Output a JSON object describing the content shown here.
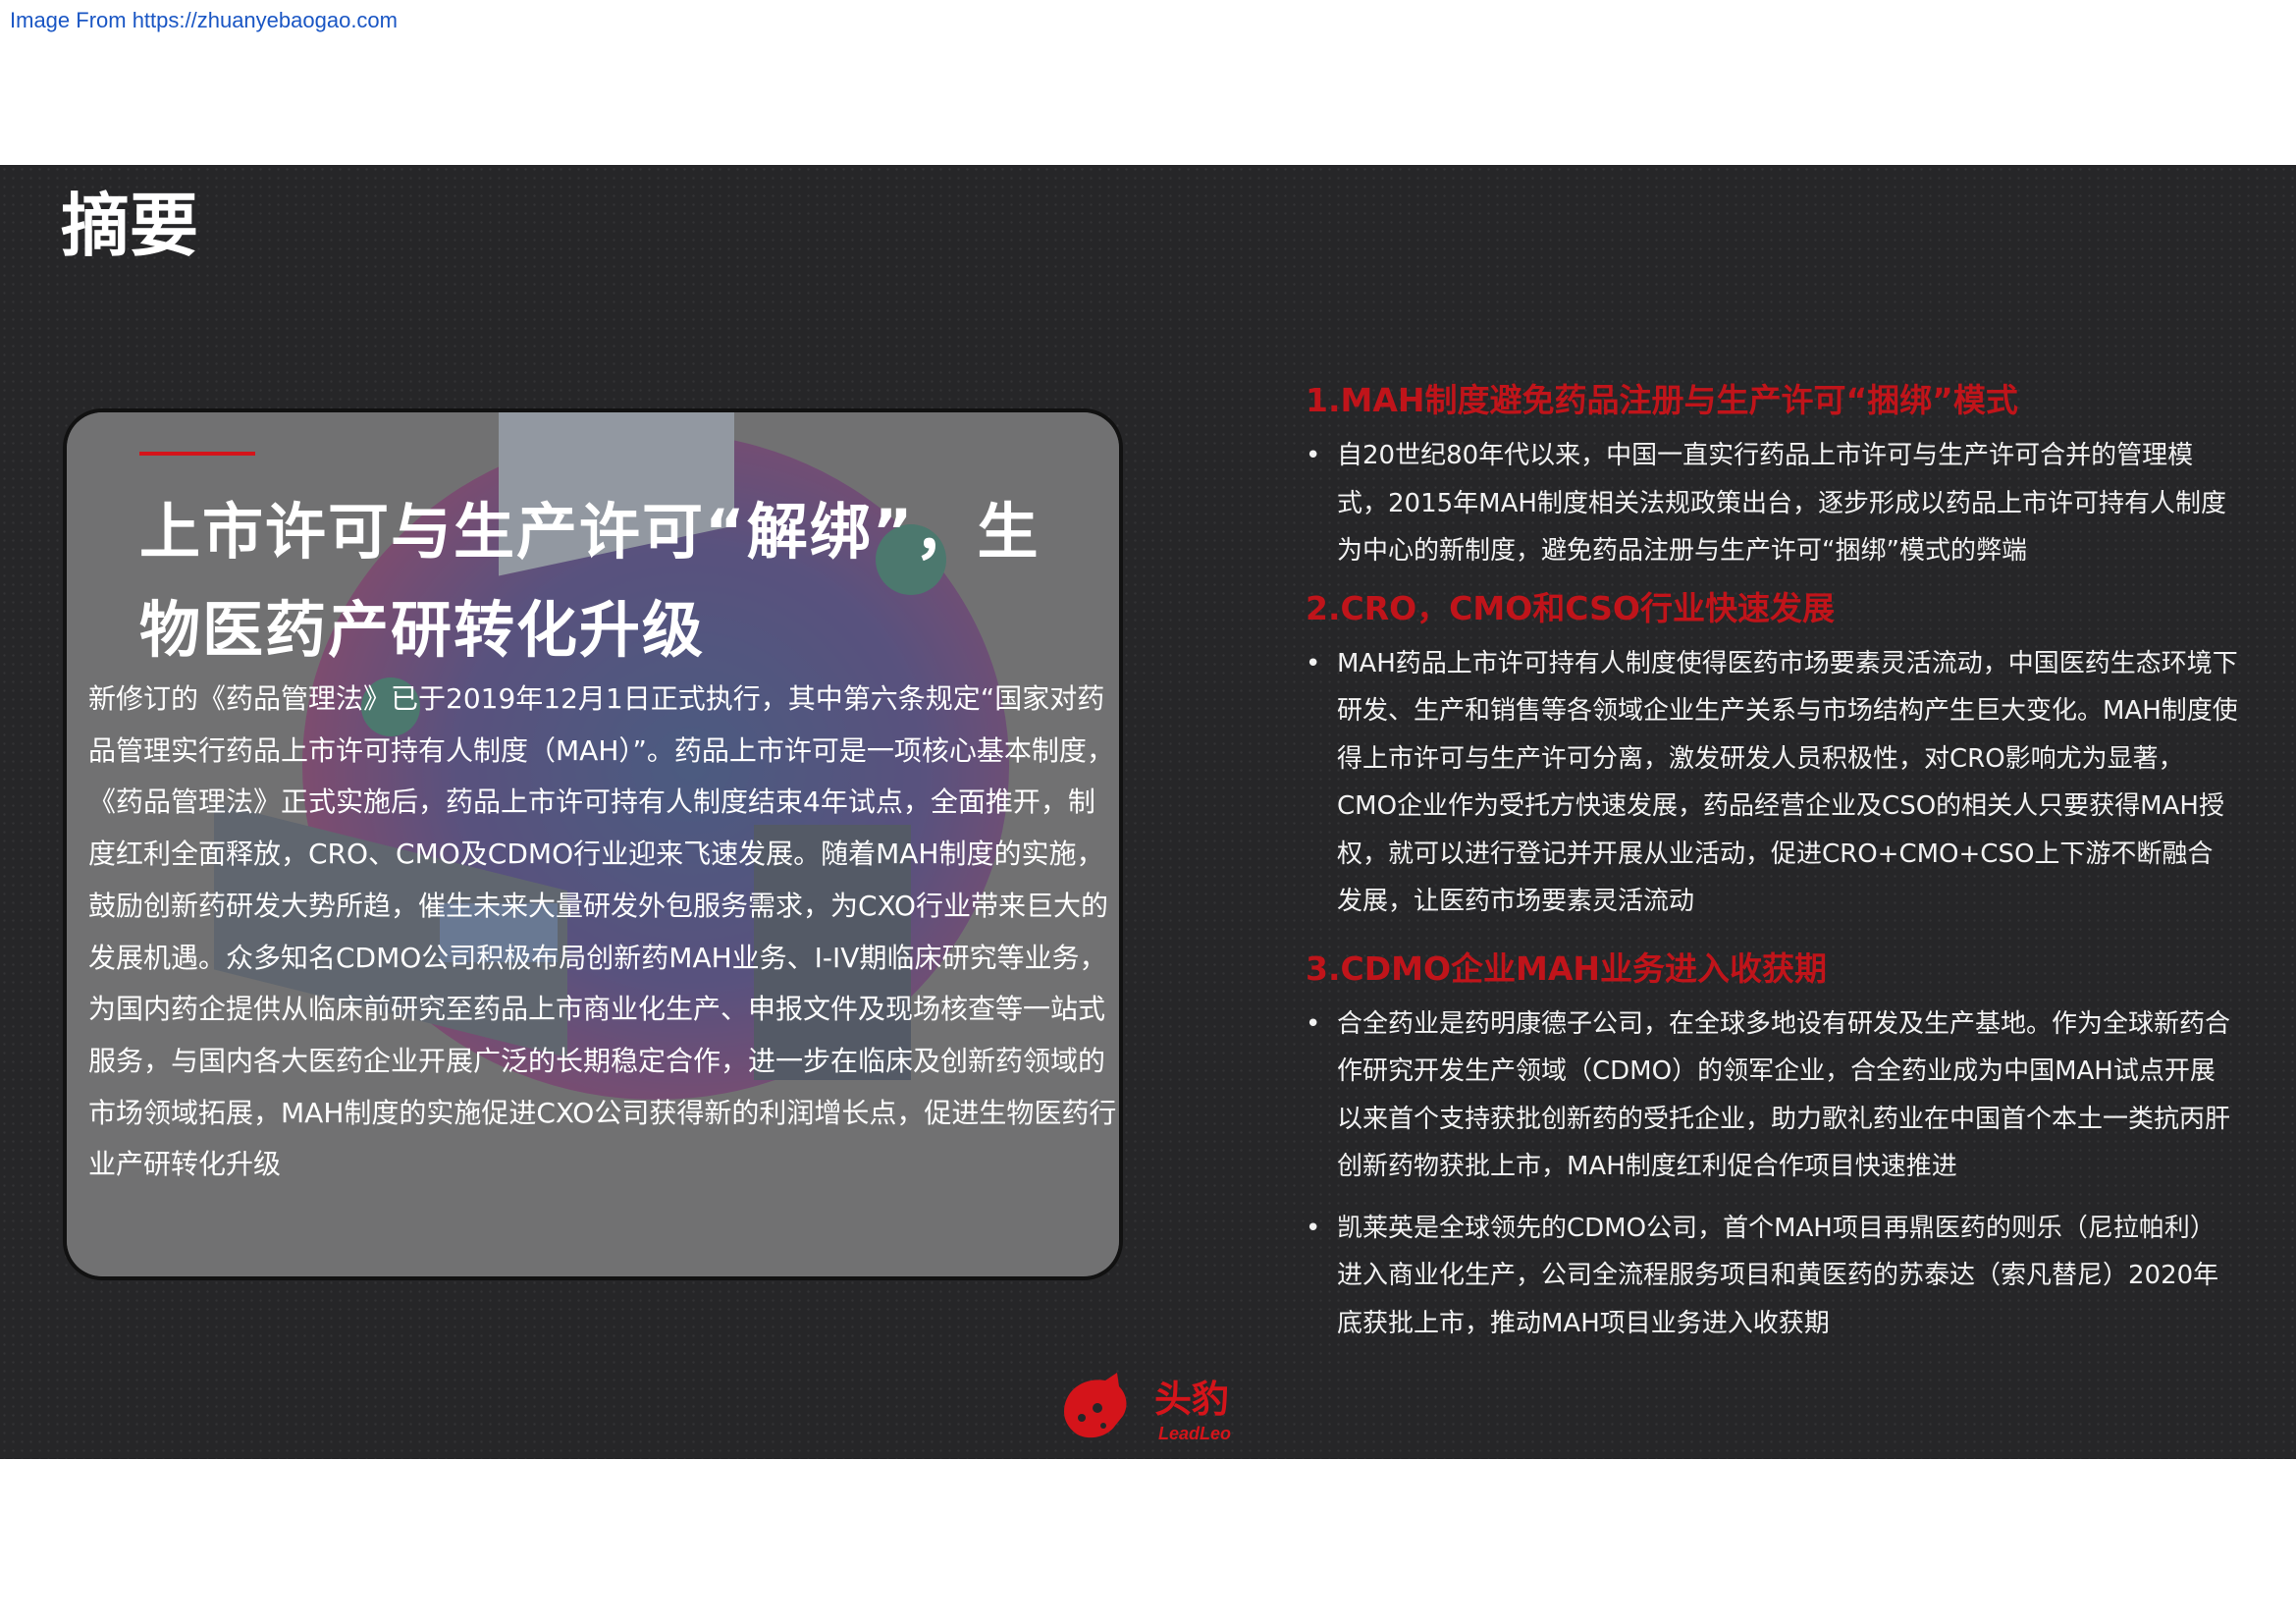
{
  "source_line": "Image From https://zhuanyebaogao.com",
  "page_title": "摘要",
  "card": {
    "headline": "上市许可与生产许可“解绑”，生物医药产研转化升级",
    "body": "新修订的《药品管理法》已于2019年12月1日正式执行，其中第六条规定“国家对药品管理实行药品上市许可持有人制度（MAH）”。药品上市许可是一项核心基本制度，《药品管理法》正式实施后，药品上市许可持有人制度结束4年试点，全面推开，制度红利全面释放，CRO、CMO及CDMO行业迎来飞速发展。随着MAH制度的实施，鼓励创新药研发大势所趋，催生未来大量研发外包服务需求，为CXO行业带来巨大的发展机遇。众多知名CDMO公司积极布局创新药MAH业务、I-IV期临床研究等业务，为国内药企提供从临床前研究至药品上市商业化生产、申报文件及现场核查等一站式服务，与国内各大医药企业开展广泛的长期稳定合作，进一步在临床及创新药领域的市场领域拓展，MAH制度的实施促进CXO公司获得新的利润增长点，促进生物医药行业产研转化升级"
  },
  "sections": [
    {
      "title": "1.MAH制度避免药品注册与生产许可“捆绑”模式",
      "bullets": [
        "自20世纪80年代以来，中国一直实行药品上市许可与生产许可合并的管理模式，2015年MAH制度相关法规政策出台，逐步形成以药品上市许可持有人制度为中心的新制度，避免药品注册与生产许可“捆绑”模式的弊端"
      ]
    },
    {
      "title": "2.CRO，CMO和CSO行业快速发展",
      "bullets": [
        "MAH药品上市许可持有人制度使得医药市场要素灵活流动，中国医药生态环境下研发、生产和销售等各领域企业生产关系与市场结构产生巨大变化。MAH制度使得上市许可与生产许可分离，激发研发人员积极性，对CRO影响尤为显著，CMO企业作为受托方快速发展，药品经营企业及CSO的相关人只要获得MAH授权，就可以进行登记并开展从业活动，促进CRO+CMO+CSO上下游不断融合发展，让医药市场要素灵活流动"
      ]
    },
    {
      "title": "3.CDMO企业MAH业务进入收获期",
      "bullets": [
        "合全药业是药明康德子公司，在全球多地设有研发及生产基地。作为全球新药合作研究开发生产领域（CDMO）的领军企业，合全药业成为中国MAH试点开展以来首个支持获批创新药的受托企业，助力歌礼药业在中国首个本土一类抗丙肝创新药物获批上市，MAH制度红利促合作项目快速推进",
        "凯莱英是全球领先的CDMO公司，首个MAH项目再鼎医药的则乐（尼拉帕利）进入商业化生产，公司全流程服务项目和黄医药的苏泰达（索凡替尼）2020年底获批上市，推动MAH项目业务进入收获期"
      ]
    }
  ],
  "logo": {
    "name_cn": "头豹",
    "name_en": "LeadLeo"
  },
  "colors": {
    "accent_red": "#d4141a",
    "slide_bg": "#262628",
    "section_title": "#c0141a"
  },
  "icons": {
    "logo": "leopard-head-icon",
    "bullet": "bullet-dot-icon"
  }
}
